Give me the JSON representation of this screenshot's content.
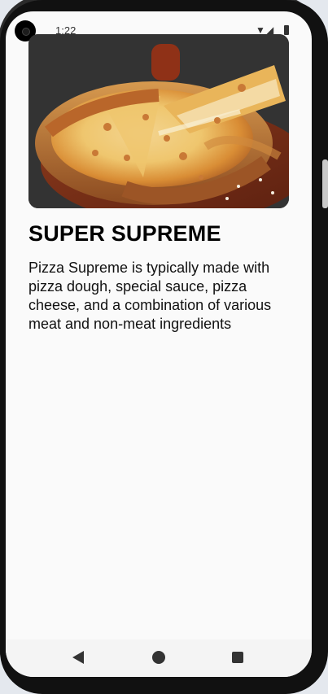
{
  "status": {
    "time": "1:22",
    "icons": [
      "wifi-icon",
      "signal-icon",
      "battery-icon"
    ]
  },
  "product": {
    "image_alt": "pizza",
    "title": "SUPER SUPREME",
    "description": "Pizza Supreme is typically made with pizza dough, special sauce, pizza cheese, and a combination of various meat and non-meat ingredients"
  },
  "navigation": {
    "buttons": [
      "back-icon",
      "home-icon",
      "recent-apps-icon"
    ]
  },
  "colors": {
    "screen_background": "#fafafa",
    "text": "#000000",
    "device_frame": "#111111"
  }
}
